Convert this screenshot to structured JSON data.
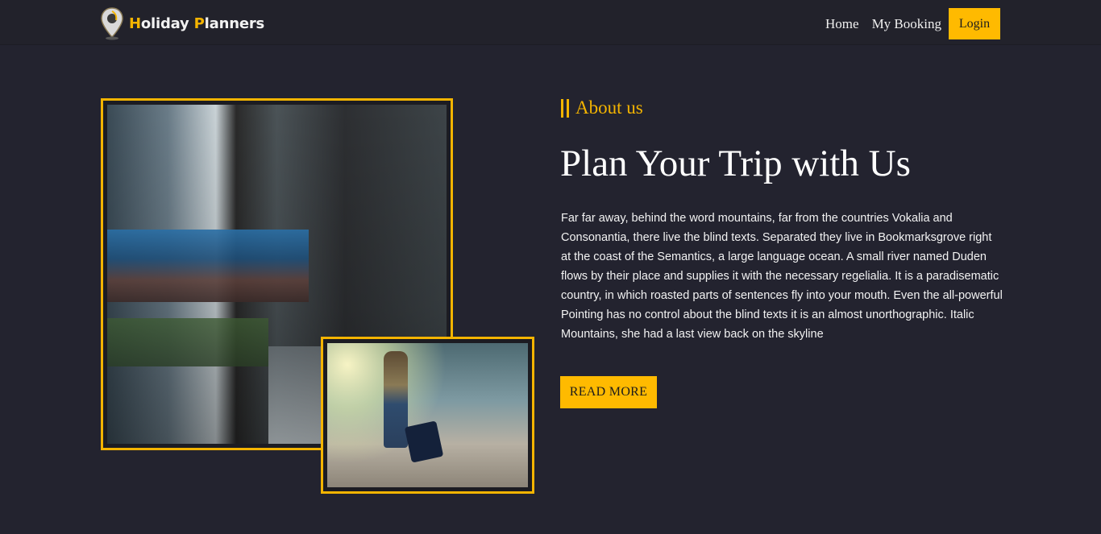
{
  "header": {
    "brand": {
      "part1": "Holiday",
      "part2": "Planners"
    },
    "nav": {
      "home": "Home",
      "my_booking": "My Booking",
      "login": "Login"
    }
  },
  "about": {
    "label": "About us",
    "headline": "Plan Your Trip with Us",
    "paragraph": "Far far away, behind the word mountains, far from the countries Vokalia and Consonantia, there live the blind texts. Separated they live in Bookmarksgrove right at the coast of the Semantics, a large language ocean. A small river named Duden flows by their place and supplies it with the necessary regelialia. It is a paradisematic country, in which roasted parts of sentences fly into your mouth. Even the all-powerful Pointing has no control about the blind texts it is an almost unorthographic. Italic Mountains, she had a last view back on the skyline",
    "button": "READ MORE"
  },
  "icons": {
    "logo": "map-pin-icon"
  },
  "colors": {
    "accent": "#f4b400",
    "background": "#23232f",
    "header_bg": "#22222b",
    "text": "#f2f2f2"
  }
}
